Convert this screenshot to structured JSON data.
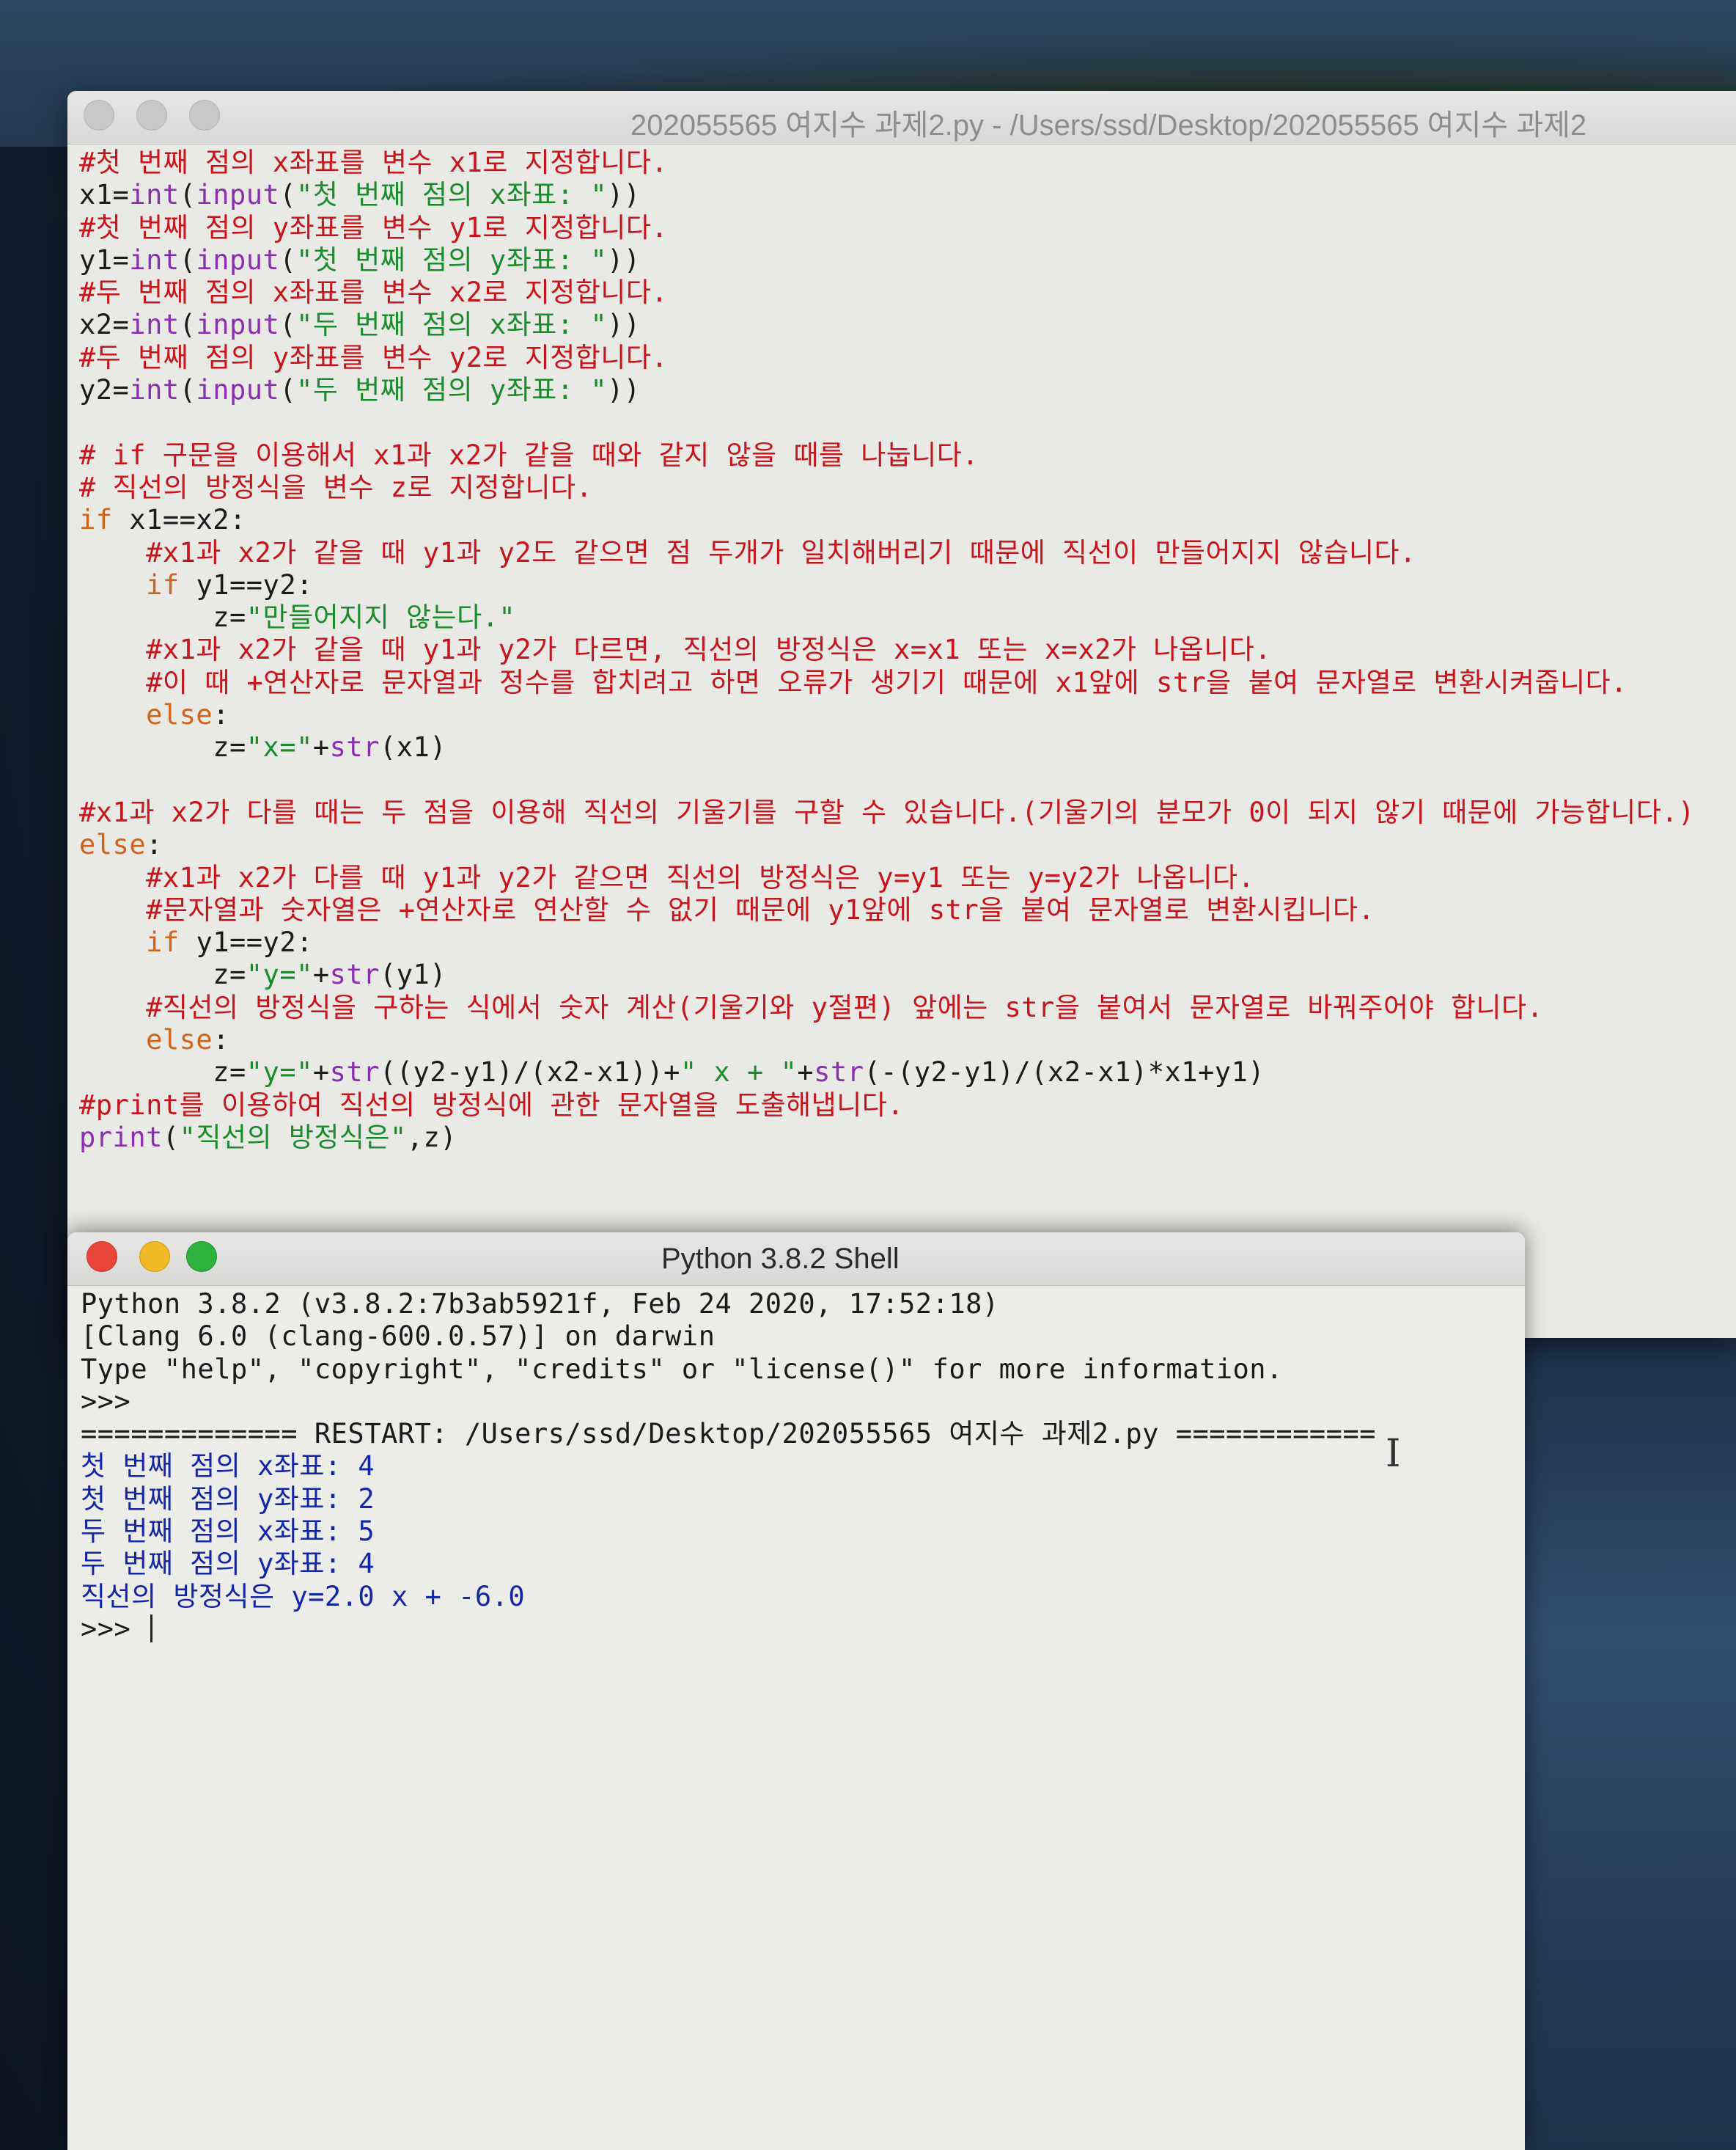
{
  "editor": {
    "title": "202055565 여지수 과제2.py - /Users/ssd/Desktop/202055565 여지수 과제2",
    "lines": [
      [
        {
          "t": "#첫 번째 점의 x좌표를 변수 x1로 지정합니다.",
          "c": "com"
        }
      ],
      [
        {
          "t": "x1=",
          "c": "def"
        },
        {
          "t": "int",
          "c": "bi"
        },
        {
          "t": "(",
          "c": "def"
        },
        {
          "t": "input",
          "c": "bi"
        },
        {
          "t": "(",
          "c": "def"
        },
        {
          "t": "\"첫 번째 점의 x좌표: \"",
          "c": "str"
        },
        {
          "t": "))",
          "c": "def"
        }
      ],
      [
        {
          "t": "#첫 번째 점의 y좌표를 변수 y1로 지정합니다.",
          "c": "com"
        }
      ],
      [
        {
          "t": "y1=",
          "c": "def"
        },
        {
          "t": "int",
          "c": "bi"
        },
        {
          "t": "(",
          "c": "def"
        },
        {
          "t": "input",
          "c": "bi"
        },
        {
          "t": "(",
          "c": "def"
        },
        {
          "t": "\"첫 번째 점의 y좌표: \"",
          "c": "str"
        },
        {
          "t": "))",
          "c": "def"
        }
      ],
      [
        {
          "t": "#두 번째 점의 x좌표를 변수 x2로 지정합니다.",
          "c": "com"
        }
      ],
      [
        {
          "t": "x2=",
          "c": "def"
        },
        {
          "t": "int",
          "c": "bi"
        },
        {
          "t": "(",
          "c": "def"
        },
        {
          "t": "input",
          "c": "bi"
        },
        {
          "t": "(",
          "c": "def"
        },
        {
          "t": "\"두 번째 점의 x좌표: \"",
          "c": "str"
        },
        {
          "t": "))",
          "c": "def"
        }
      ],
      [
        {
          "t": "#두 번째 점의 y좌표를 변수 y2로 지정합니다.",
          "c": "com"
        }
      ],
      [
        {
          "t": "y2=",
          "c": "def"
        },
        {
          "t": "int",
          "c": "bi"
        },
        {
          "t": "(",
          "c": "def"
        },
        {
          "t": "input",
          "c": "bi"
        },
        {
          "t": "(",
          "c": "def"
        },
        {
          "t": "\"두 번째 점의 y좌표: \"",
          "c": "str"
        },
        {
          "t": "))",
          "c": "def"
        }
      ],
      [],
      [
        {
          "t": "# if 구문을 이용해서 x1과 x2가 같을 때와 같지 않을 때를 나눕니다.",
          "c": "com"
        }
      ],
      [
        {
          "t": "# 직선의 방정식을 변수 z로 지정합니다.",
          "c": "com"
        }
      ],
      [
        {
          "t": "if",
          "c": "kw"
        },
        {
          "t": " x1==x2:",
          "c": "def"
        }
      ],
      [
        {
          "t": "    ",
          "c": "def"
        },
        {
          "t": "#x1과 x2가 같을 때 y1과 y2도 같으면 점 두개가 일치해버리기 때문에 직선이 만들어지지 않습니다.",
          "c": "com"
        }
      ],
      [
        {
          "t": "    ",
          "c": "def"
        },
        {
          "t": "if",
          "c": "kw"
        },
        {
          "t": " y1==y2:",
          "c": "def"
        }
      ],
      [
        {
          "t": "        z=",
          "c": "def"
        },
        {
          "t": "\"만들어지지 않는다.\"",
          "c": "str"
        }
      ],
      [
        {
          "t": "    ",
          "c": "def"
        },
        {
          "t": "#x1과 x2가 같을 때 y1과 y2가 다르면, 직선의 방정식은 x=x1 또는 x=x2가 나옵니다.",
          "c": "com"
        }
      ],
      [
        {
          "t": "    ",
          "c": "def"
        },
        {
          "t": "#이 때 +연산자로 문자열과 정수를 합치려고 하면 오류가 생기기 때문에 x1앞에 str을 붙여 문자열로 변환시켜줍니다.",
          "c": "com"
        }
      ],
      [
        {
          "t": "    ",
          "c": "def"
        },
        {
          "t": "else",
          "c": "kw"
        },
        {
          "t": ":",
          "c": "def"
        }
      ],
      [
        {
          "t": "        z=",
          "c": "def"
        },
        {
          "t": "\"x=\"",
          "c": "str"
        },
        {
          "t": "+",
          "c": "def"
        },
        {
          "t": "str",
          "c": "bi"
        },
        {
          "t": "(x1)",
          "c": "def"
        }
      ],
      [],
      [
        {
          "t": "#x1과 x2가 다를 때는 두 점을 이용해 직선의 기울기를 구할 수 있습니다.(기울기의 분모가 0이 되지 않기 때문에 가능합니다.)",
          "c": "com"
        }
      ],
      [
        {
          "t": "else",
          "c": "kw"
        },
        {
          "t": ":",
          "c": "def"
        }
      ],
      [
        {
          "t": "    ",
          "c": "def"
        },
        {
          "t": "#x1과 x2가 다를 때 y1과 y2가 같으면 직선의 방정식은 y=y1 또는 y=y2가 나옵니다.",
          "c": "com"
        }
      ],
      [
        {
          "t": "    ",
          "c": "def"
        },
        {
          "t": "#문자열과 숫자열은 +연산자로 연산할 수 없기 때문에 y1앞에 str을 붙여 문자열로 변환시킵니다.",
          "c": "com"
        }
      ],
      [
        {
          "t": "    ",
          "c": "def"
        },
        {
          "t": "if",
          "c": "kw"
        },
        {
          "t": " y1==y2:",
          "c": "def"
        }
      ],
      [
        {
          "t": "        z=",
          "c": "def"
        },
        {
          "t": "\"y=\"",
          "c": "str"
        },
        {
          "t": "+",
          "c": "def"
        },
        {
          "t": "str",
          "c": "bi"
        },
        {
          "t": "(y1)",
          "c": "def"
        }
      ],
      [
        {
          "t": "    ",
          "c": "def"
        },
        {
          "t": "#직선의 방정식을 구하는 식에서 숫자 계산(기울기와 y절편) 앞에는 str을 붙여서 문자열로 바꿔주어야 합니다.",
          "c": "com"
        }
      ],
      [
        {
          "t": "    ",
          "c": "def"
        },
        {
          "t": "else",
          "c": "kw"
        },
        {
          "t": ":",
          "c": "def"
        }
      ],
      [
        {
          "t": "        z=",
          "c": "def"
        },
        {
          "t": "\"y=\"",
          "c": "str"
        },
        {
          "t": "+",
          "c": "def"
        },
        {
          "t": "str",
          "c": "bi"
        },
        {
          "t": "((y2-y1)/(x2-x1))+",
          "c": "def"
        },
        {
          "t": "\" x + \"",
          "c": "str"
        },
        {
          "t": "+",
          "c": "def"
        },
        {
          "t": "str",
          "c": "bi"
        },
        {
          "t": "(-(y2-y1)/(x2-x1)*x1+y1)",
          "c": "def"
        }
      ],
      [
        {
          "t": "#print를 이용하여 직선의 방정식에 관한 문자열을 도출해냅니다.",
          "c": "com"
        }
      ],
      [
        {
          "t": "print",
          "c": "bi"
        },
        {
          "t": "(",
          "c": "def"
        },
        {
          "t": "\"직선의 방정식은\"",
          "c": "str"
        },
        {
          "t": ",z)",
          "c": "def"
        }
      ]
    ]
  },
  "shell": {
    "title": "Python 3.8.2 Shell",
    "lines": [
      {
        "t": "Python 3.8.2 (v3.8.2:7b3ab5921f, Feb 24 2020, 17:52:18)",
        "c": "out"
      },
      {
        "t": "[Clang 6.0 (clang-600.0.57)] on darwin",
        "c": "out"
      },
      {
        "t": "Type \"help\", \"copyright\", \"credits\" or \"license()\" for more information.",
        "c": "out"
      },
      {
        "t": ">>>",
        "c": "out"
      },
      {
        "t": "============= RESTART: /Users/ssd/Desktop/202055565 여지수 과제2.py ============",
        "c": "out"
      },
      {
        "t": "첫 번째 점의 x좌표: 4",
        "c": "in"
      },
      {
        "t": "첫 번째 점의 y좌표: 2",
        "c": "in"
      },
      {
        "t": "두 번째 점의 x좌표: 5",
        "c": "in"
      },
      {
        "t": "두 번째 점의 y좌표: 4",
        "c": "in"
      },
      {
        "t": "직선의 방정식은 y=2.0 x + -6.0",
        "c": "in"
      }
    ],
    "prompt": ">>> "
  },
  "colors": {
    "comment": "#c8141b",
    "keyword": "#d2641a",
    "builtin": "#8a2fb0",
    "string": "#1a8c2b",
    "default": "#1b1b1b",
    "shell_input": "#1426a8"
  }
}
